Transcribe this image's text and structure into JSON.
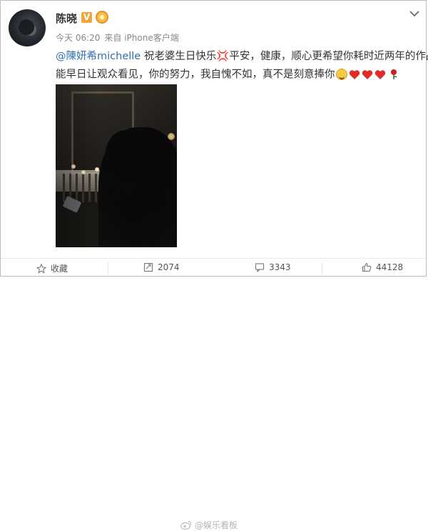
{
  "post": {
    "author": "陈晓",
    "verified_badge": "V",
    "timestamp": "今天 06:20",
    "source": "来自 iPhone客户端",
    "text_mention": "@陳妍希michelle",
    "text_line1_rest": " 祝老婆生日快乐💢平安，健康，顺心更希望你耗时近两年的作品",
    "text_line2": "能早日让观众看见，你的努力，我自愧不如，真不是刻意捧你"
  },
  "actions": {
    "favorite_label": "收藏",
    "repost_count": "2074",
    "comment_count": "3343",
    "like_count": "44128"
  },
  "watermark": "@娱乐看板",
  "colors": {
    "mention": "#2f6fb0",
    "badge": "#f2a63a",
    "heart": "#e02b2b"
  },
  "icons": [
    "chevron-down-icon",
    "star-icon",
    "repost-icon",
    "comment-icon",
    "like-icon",
    "smile-emoji",
    "heart-emoji",
    "rose-emoji"
  ]
}
